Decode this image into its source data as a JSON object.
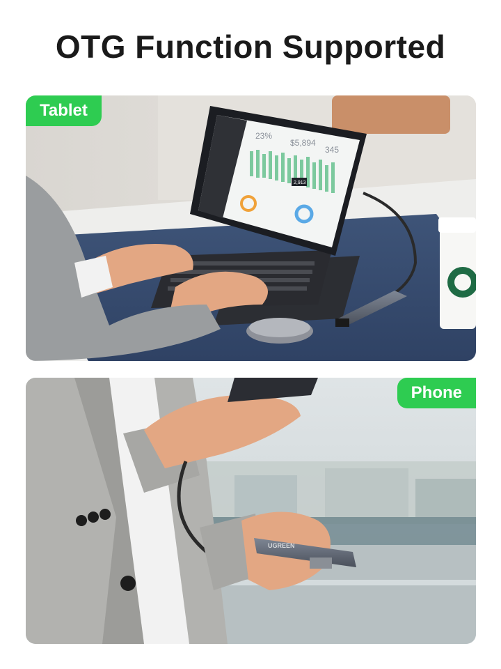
{
  "heading": "OTG Function Supported",
  "panels": {
    "tablet": {
      "label": "Tablet",
      "screen_stat_1": "23%",
      "screen_stat_2": "$5,894",
      "screen_stat_3": "345",
      "screen_marker": "2,913"
    },
    "phone": {
      "label": "Phone",
      "hub_brand": "UGREEN"
    }
  },
  "colors": {
    "badge": "#2ecc51",
    "title": "#1a1a1a"
  }
}
